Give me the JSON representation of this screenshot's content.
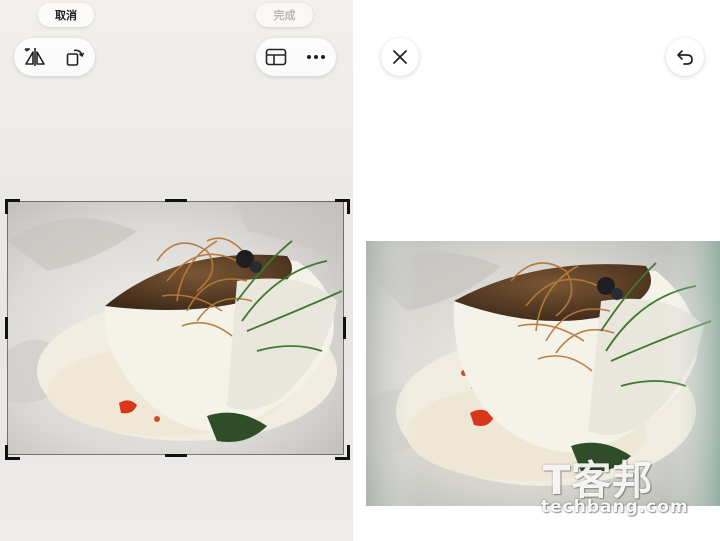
{
  "editor_left": {
    "cancel_label": "取消",
    "done_label": "完成",
    "tools_left": [
      {
        "icon": "flip-horizontal-icon"
      },
      {
        "icon": "rotate-icon"
      }
    ],
    "tools_right": [
      {
        "icon": "aspect-ratio-icon"
      },
      {
        "icon": "more-icon"
      }
    ],
    "photo_subject": "seared fish fillet with crispy fried topping, greens and cream sauce"
  },
  "editor_right": {
    "close_icon": "close-icon",
    "undo_icon": "undo-icon"
  },
  "watermark": {
    "chinese": "T客邦",
    "domain": "techbang.com"
  },
  "colors": {
    "inactive_text": "#b9b7b4",
    "icon": "#222222",
    "crop_handles": "#111111"
  }
}
